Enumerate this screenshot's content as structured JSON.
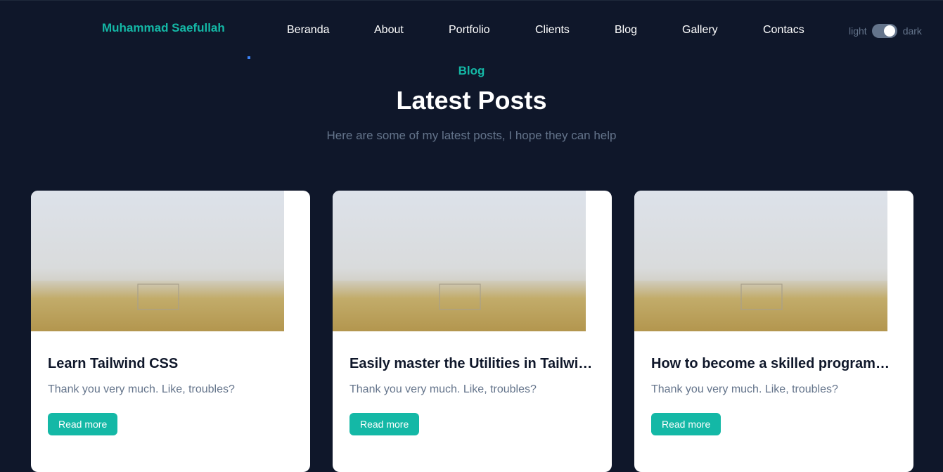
{
  "navbar": {
    "brand": "Muhammad Saefullah",
    "links": [
      "Beranda",
      "About",
      "Portfolio",
      "Clients",
      "Blog",
      "Gallery",
      "Contacs"
    ],
    "toggle": {
      "light_label": "light",
      "dark_label": "dark",
      "state": "dark"
    }
  },
  "section": {
    "eyebrow": "Blog",
    "title": "Latest Posts",
    "subtitle": "Here are some of my latest posts, I hope they can help"
  },
  "posts": [
    {
      "title": "Learn Tailwind CSS",
      "excerpt": "Thank you very much. Like, troubles?",
      "button": "Read more"
    },
    {
      "title": "Easily master the Utilities in Tailwind CSS",
      "excerpt": "Thank you very much. Like, troubles?",
      "button": "Read more"
    },
    {
      "title": "How to become a skilled programmer",
      "excerpt": "Thank you very much. Like, troubles?",
      "button": "Read more"
    }
  ],
  "colors": {
    "background": "#0f172a",
    "accent": "#14b8a6",
    "muted": "#64748b",
    "card": "#ffffff"
  }
}
